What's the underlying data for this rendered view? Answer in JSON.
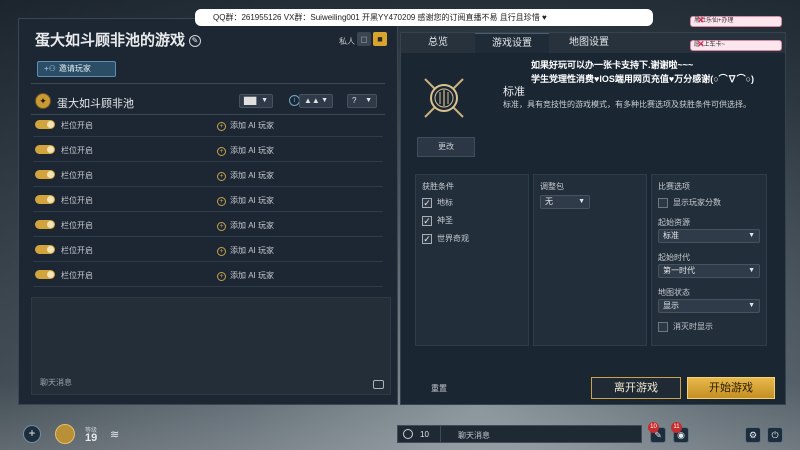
{
  "lobby": {
    "title": "蛋大如斗顾非池的游戏",
    "edit_icon": "✎",
    "private_label": "私人",
    "invite_button": "邀请玩家",
    "host": {
      "name": "蛋大如斗顾非池",
      "civ_dropdown": "▇▇",
      "team_dropdown": "▲▲",
      "handicap_dropdown": "?"
    },
    "slots": [
      {
        "label": "栏位开启",
        "action": "添加 AI 玩家"
      },
      {
        "label": "栏位开启",
        "action": "添加 AI 玩家"
      },
      {
        "label": "栏位开启",
        "action": "添加 AI 玩家"
      },
      {
        "label": "栏位开启",
        "action": "添加 AI 玩家"
      },
      {
        "label": "栏位开启",
        "action": "添加 AI 玩家"
      },
      {
        "label": "栏位开启",
        "action": "添加 AI 玩家"
      },
      {
        "label": "栏位开启",
        "action": "添加 AI 玩家"
      }
    ],
    "chat_placeholder": "聊天消息"
  },
  "settings": {
    "tabs": [
      "总览",
      "游戏设置",
      "地图设置"
    ],
    "mode_title": "标准",
    "mode_description": "标准，具有竞技性的游戏模式，有多种比赛选项及获胜条件可供选择。",
    "change_button": "更改",
    "victory": {
      "title": "获胜条件",
      "items": [
        {
          "label": "地标",
          "checked": true
        },
        {
          "label": "神圣",
          "checked": true
        },
        {
          "label": "世界奇观",
          "checked": true
        }
      ]
    },
    "adjust": {
      "title": "调整包",
      "value": "无"
    },
    "options": {
      "title": "比赛选项",
      "show_score": "显示玩家分数",
      "starting_resources_label": "起始资源",
      "starting_resources": "标准",
      "starting_age_label": "起始时代",
      "starting_age": "第一时代",
      "map_state_label": "地图状态",
      "map_state": "显示",
      "disappear_label": "消灭时显示"
    },
    "reset_label": "重置",
    "leave_button": "离开游戏",
    "start_button": "开始游戏"
  },
  "overlay": {
    "banner": "QQ群：261955126 VX群：Suiweiling001 开黑YY470209 感谢您的订阅直播不易 且行且珍惜 ♥",
    "note1": "如果好玩可以办一张卡支持下.谢谢啦~~~",
    "note2": "学生党理性消费♥IOS端用网页充值♥万分感谢(○⌒∇⌒○)",
    "chip1": "黑社乐仙+办理",
    "chip2": "愿~上车卡~"
  },
  "bottom": {
    "plus": "+",
    "level_label": "等级",
    "level": "19",
    "wifi": "≋",
    "friends_count": "10",
    "chat_placeholder": "聊天消息",
    "badge1": "10",
    "badge2": "11"
  },
  "colors": {
    "accent_gold": "#d2a43d",
    "panel": "#1c2733",
    "start_button": "#e7b84a"
  },
  "icons": [
    "edit-icon",
    "lock-icon",
    "invite-icon",
    "leader-icon",
    "info-icon",
    "plus-icon",
    "chat-icon",
    "wifi-icon",
    "friends-icon",
    "settings-icon",
    "power-icon"
  ]
}
